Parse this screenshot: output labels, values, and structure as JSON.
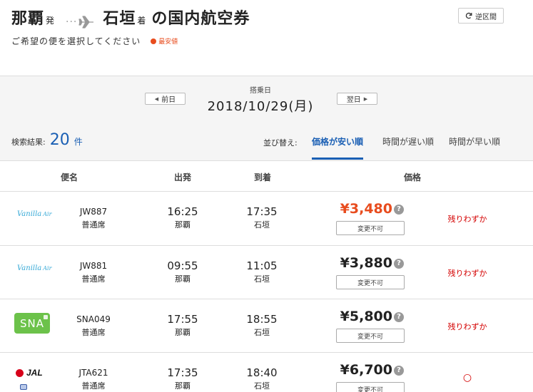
{
  "header": {
    "origin": "那覇",
    "origin_suffix": "発",
    "destination": "石垣",
    "destination_suffix": "着",
    "title_tail": "の国内航空券",
    "subtitle": "ご希望の便を選択してください",
    "cheapest_legend": "最安値",
    "swap_button": "逆区間"
  },
  "date_bar": {
    "label": "搭乗日",
    "date": "2018/10/29(月)",
    "prev_button": "前日",
    "next_button": "翌日"
  },
  "results": {
    "label": "検索結果:",
    "count": "20",
    "unit": "件",
    "sort_label": "並び替え:",
    "sort_options": [
      "価格が安い順",
      "時間が遅い順",
      "時間が早い順"
    ],
    "sort_active": "価格が安い順"
  },
  "table_headers": {
    "flight": "便名",
    "departure": "出発",
    "arrival": "到着",
    "price": "価格"
  },
  "flights": [
    {
      "airline_logo": "vanilla-air-logo",
      "logo_text": "Vanilla",
      "logo_text2": "Air",
      "flight_no": "JW887",
      "seat": "普通席",
      "dep_time": "16:25",
      "dep_city": "那覇",
      "arr_time": "17:35",
      "arr_city": "石垣",
      "price": "¥3,480",
      "cheapest": true,
      "fare_rule": "変更不可",
      "availability": "残りわずか"
    },
    {
      "airline_logo": "vanilla-air-logo",
      "logo_text": "Vanilla",
      "logo_text2": "Air",
      "flight_no": "JW881",
      "seat": "普通席",
      "dep_time": "09:55",
      "dep_city": "那覇",
      "arr_time": "11:05",
      "arr_city": "石垣",
      "price": "¥3,880",
      "cheapest": false,
      "fare_rule": "変更不可",
      "availability": "残りわずか"
    },
    {
      "airline_logo": "sna-logo",
      "logo_text": "SNA",
      "flight_no": "SNA049",
      "seat": "普通席",
      "dep_time": "17:55",
      "dep_city": "那覇",
      "arr_time": "18:55",
      "arr_city": "石垣",
      "price": "¥5,800",
      "cheapest": false,
      "fare_rule": "変更不可",
      "availability": "残りわずか"
    },
    {
      "airline_logo": "jal-logo",
      "logo_text": "JAL",
      "flight_no": "JTA621",
      "seat": "普通席",
      "dep_time": "17:35",
      "dep_city": "那覇",
      "arr_time": "18:40",
      "arr_city": "石垣",
      "price": "¥6,700",
      "cheapest": false,
      "fare_rule": "変更不可",
      "availability": "○"
    }
  ],
  "colors": {
    "accent_blue": "#1a5fb4",
    "cheapest_orange": "#e84c1e",
    "availability_red": "#d40000",
    "band_gray": "#f5f5f5"
  }
}
